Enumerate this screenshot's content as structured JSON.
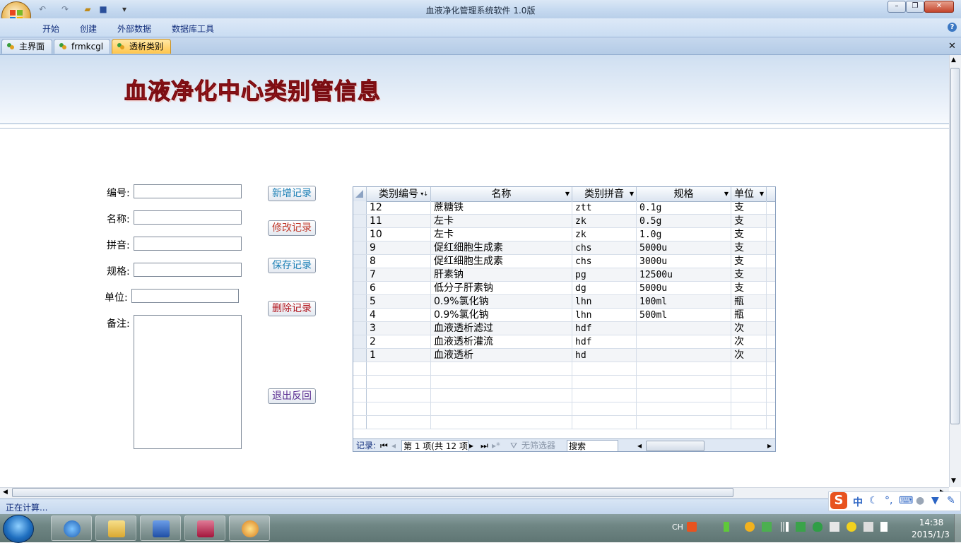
{
  "window": {
    "title": "血液净化管理系统软件 1.0版"
  },
  "ribbon": {
    "menus": [
      "开始",
      "创建",
      "外部数据",
      "数据库工具"
    ]
  },
  "tabs": [
    "主界面",
    "frmkcgl",
    "透析类别"
  ],
  "form": {
    "title": "血液净化中心类别管信息",
    "labels": {
      "id": "编号:",
      "name": "名称:",
      "pinyin": "拼音:",
      "spec": "规格:",
      "unit": "单位:",
      "remark": "备注:"
    },
    "buttons": {
      "add": "新增记录",
      "modify": "修改记录",
      "save": "保存记录",
      "delete": "删除记录",
      "exit": "退出反回"
    },
    "button_colors": {
      "add": "#1b7fb5",
      "modify": "#c0392b",
      "save": "#1b7fb5",
      "delete": "#b0121b",
      "exit": "#5a2d91"
    }
  },
  "grid": {
    "columns": [
      "类别编号",
      "名称",
      "类别拼音",
      "规格",
      "单位"
    ],
    "rows": [
      [
        "12",
        "蔗糖铁",
        "ztt",
        "0.1g",
        "支"
      ],
      [
        "11",
        "左卡",
        "zk",
        "0.5g",
        "支"
      ],
      [
        "10",
        "左卡",
        "zk",
        "1.0g",
        "支"
      ],
      [
        "9",
        "促红细胞生成素",
        "chs",
        "5000u",
        "支"
      ],
      [
        "8",
        "促红细胞生成素",
        "chs",
        "3000u",
        "支"
      ],
      [
        "7",
        "肝素钠",
        "pg",
        "12500u",
        "支"
      ],
      [
        "6",
        "低分子肝素钠",
        "dg",
        "5000u",
        "支"
      ],
      [
        "5",
        "0.9%氯化钠",
        "lhn",
        "100ml",
        "瓶"
      ],
      [
        "4",
        "0.9%氯化钠",
        "lhn",
        "500ml",
        "瓶"
      ],
      [
        "3",
        "血液透析滤过",
        "hdf",
        "",
        "次"
      ],
      [
        "2",
        "血液透析灌流",
        "hdf",
        "",
        "次"
      ],
      [
        "1",
        "血液透析",
        "hd",
        "",
        "次"
      ]
    ],
    "nav": {
      "records_label": "记录:",
      "position": "第 1 项(共 12 项",
      "filter": "无筛选器",
      "search": "搜索"
    }
  },
  "status": {
    "text": "正在计算..."
  },
  "ime": {
    "items": [
      "中",
      "☾",
      "°,",
      "⌨"
    ]
  },
  "taskbar": {
    "lang": "CH",
    "time": "14:38",
    "date": "2015/1/3"
  }
}
